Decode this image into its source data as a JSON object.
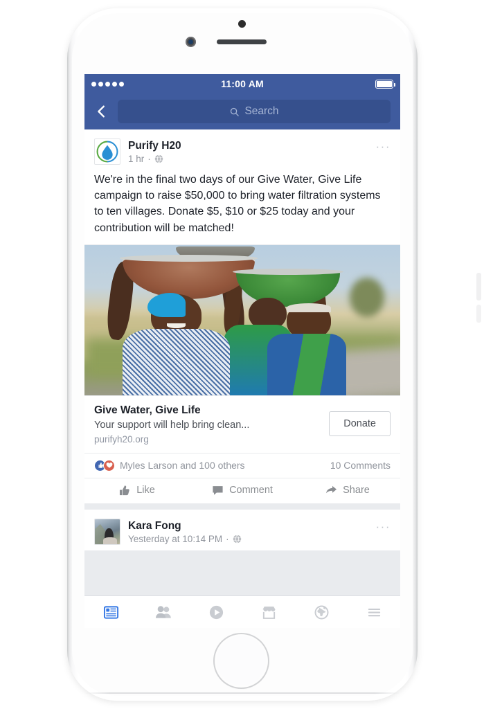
{
  "status_bar": {
    "signal_dots": 5,
    "time": "11:00 AM",
    "battery_icon": "battery-full-icon"
  },
  "nav_bar": {
    "back_icon": "back-chevron-icon",
    "search_icon": "search-icon",
    "search_placeholder": "Search",
    "search_value": ""
  },
  "colors": {
    "facebook_blue": "#3f5b9e",
    "search_field": "#36508d",
    "feed_background": "#e9ebee",
    "card_background": "#ffffff",
    "primary_text": "#1d2129",
    "secondary_text": "#90949c",
    "like_blue": "#4267b2",
    "love_red": "#d9604f",
    "active_tab": "#3578e5"
  },
  "posts": [
    {
      "avatar_icon": "water-drop-logo-icon",
      "author": "Purify H20",
      "timestamp": "1 hr",
      "separator": "·",
      "audience_icon": "globe-public-icon",
      "more_options": "···",
      "body": "We're in the final two days of our Give Water, Give Life campaign to raise $50,000 to bring water filtration systems to ten villages. Donate $5, $10 or $25 today and your contribution will be matched!",
      "link_card": {
        "image_alt": "girls-carrying-water-bowls-photo",
        "title": "Give Water, Give Life",
        "description": "Your support will help bring clean...",
        "url": "purifyh20.org",
        "cta_label": "Donate"
      },
      "reactions": {
        "icons": [
          "like-reaction-icon",
          "love-reaction-icon"
        ],
        "summary": "Myles Larson and 100 others",
        "comments": "10 Comments"
      },
      "actions": [
        {
          "icon": "thumbs-up-icon",
          "label": "Like"
        },
        {
          "icon": "comment-bubble-icon",
          "label": "Comment"
        },
        {
          "icon": "share-arrow-icon",
          "label": "Share"
        }
      ]
    },
    {
      "avatar_icon": "kara-fong-profile-photo",
      "author": "Kara Fong",
      "timestamp": "Yesterday at 10:14 PM",
      "separator": "·",
      "audience_icon": "globe-public-icon",
      "more_options": "···"
    }
  ],
  "tab_bar": {
    "items": [
      {
        "icon": "news-feed-icon",
        "label": "News Feed",
        "active": true
      },
      {
        "icon": "friends-icon",
        "label": "Friend Requests",
        "active": false
      },
      {
        "icon": "watch-video-icon",
        "label": "Watch",
        "active": false
      },
      {
        "icon": "marketplace-icon",
        "label": "Marketplace",
        "active": false
      },
      {
        "icon": "notifications-globe-icon",
        "label": "Notifications",
        "active": false
      },
      {
        "icon": "hamburger-menu-icon",
        "label": "Menu",
        "active": false
      }
    ]
  },
  "device": {
    "sensor_icon": "proximity-sensor-dot",
    "camera_icon": "front-camera-icon",
    "speaker_icon": "earpiece-speaker-icon",
    "home_button_icon": "home-button-icon"
  }
}
